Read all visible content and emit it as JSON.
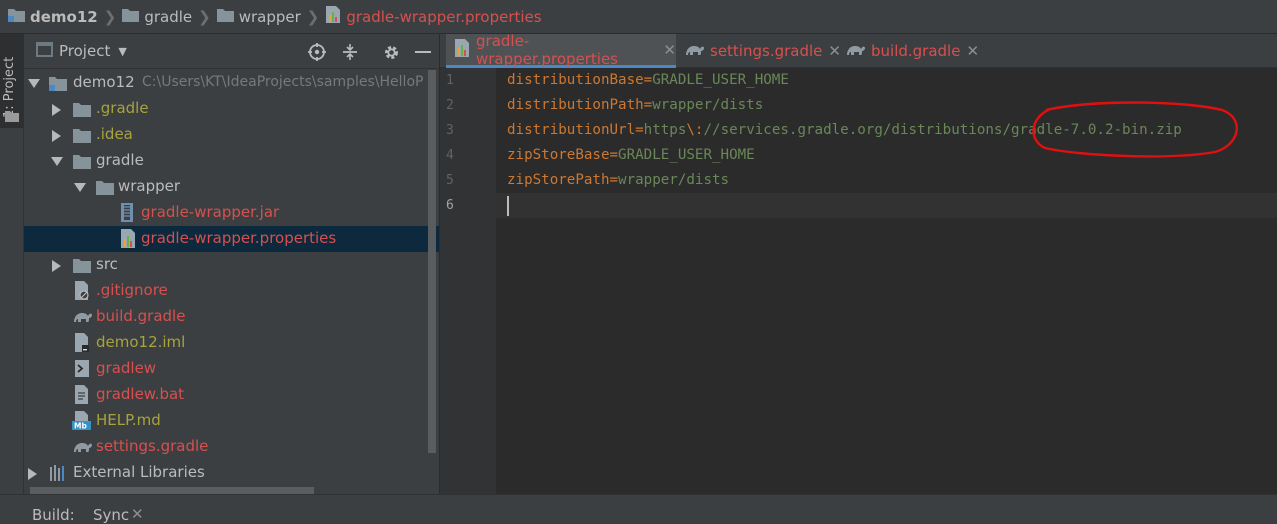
{
  "navbar": {
    "breadcrumbs": [
      {
        "label": "demo12",
        "icon": "project-folder-icon"
      },
      {
        "label": "gradle",
        "icon": "folder-icon"
      },
      {
        "label": "wrapper",
        "icon": "folder-icon"
      },
      {
        "label": "gradle-wrapper.properties",
        "icon": "properties-file-icon"
      }
    ]
  },
  "left_strip": {
    "project_tab": "1: Project"
  },
  "project_panel": {
    "title": "Project",
    "tools": [
      "locate-icon",
      "collapse-all-icon",
      "gear-icon",
      "hide-icon"
    ],
    "tree": [
      {
        "label": "demo12",
        "path": "C:\\Users\\KT\\IdeaProjects\\samples\\HelloP",
        "icon": "module-folder-icon",
        "expanded": true,
        "color": "default"
      },
      {
        "label": ".gradle",
        "icon": "folder-icon",
        "expanded": false,
        "color": "yellow"
      },
      {
        "label": ".idea",
        "icon": "folder-icon",
        "expanded": false,
        "color": "yellow"
      },
      {
        "label": "gradle",
        "icon": "folder-icon",
        "expanded": true,
        "color": "default"
      },
      {
        "label": "wrapper",
        "icon": "folder-icon",
        "expanded": true,
        "color": "default"
      },
      {
        "label": "gradle-wrapper.jar",
        "icon": "jar-file-icon",
        "color": "red"
      },
      {
        "label": "gradle-wrapper.properties",
        "icon": "properties-file-icon",
        "color": "red",
        "selected": true
      },
      {
        "label": "src",
        "icon": "folder-icon",
        "expanded": false,
        "color": "default"
      },
      {
        "label": ".gitignore",
        "icon": "gitignore-file-icon",
        "color": "red"
      },
      {
        "label": "build.gradle",
        "icon": "gradle-file-icon",
        "color": "red"
      },
      {
        "label": "demo12.iml",
        "icon": "iml-file-icon",
        "color": "yellow"
      },
      {
        "label": "gradlew",
        "icon": "shell-script-icon",
        "color": "red"
      },
      {
        "label": "gradlew.bat",
        "icon": "bat-file-icon",
        "color": "red"
      },
      {
        "label": "HELP.md",
        "icon": "markdown-file-icon",
        "color": "yellow"
      },
      {
        "label": "settings.gradle",
        "icon": "gradle-file-icon",
        "color": "red"
      },
      {
        "label": "External Libraries",
        "icon": "libraries-icon",
        "expanded": false,
        "color": "default"
      }
    ]
  },
  "editor": {
    "tabs": [
      {
        "label": "gradle-wrapper.properties",
        "icon": "properties-file-icon",
        "active": true,
        "color": "red"
      },
      {
        "label": "settings.gradle",
        "icon": "gradle-file-icon",
        "active": false,
        "color": "red"
      },
      {
        "label": "build.gradle",
        "icon": "gradle-file-icon",
        "active": false,
        "color": "red"
      }
    ],
    "lines": [
      {
        "num": "1",
        "key": "distributionBase",
        "value": "GRADLE_USER_HOME"
      },
      {
        "num": "2",
        "key": "distributionPath",
        "value": "wrapper/dists"
      },
      {
        "num": "3",
        "key": "distributionUrl",
        "value_a": "https",
        "value_esc": "\\:",
        "value_b": "//services.gradle.org/distributions/gradle-7.0.2-bin.zip"
      },
      {
        "num": "4",
        "key": "zipStoreBase",
        "value": "GRADLE_USER_HOME"
      },
      {
        "num": "5",
        "key": "zipStorePath",
        "value": "wrapper/dists"
      },
      {
        "num": "6",
        "key": "",
        "value": ""
      }
    ],
    "current_line": "6"
  },
  "bottom": {
    "build_label": "Build:",
    "sync_tab": "Sync"
  },
  "colors": {
    "bg": "#2b2b2b",
    "panel": "#3c3f41",
    "selection": "#0d293e",
    "accent": "#4a88c7",
    "key": "#cc7832",
    "value": "#6a8759",
    "vcs_red": "#d7504f",
    "vcs_yellow": "#a8a33c",
    "annotation": "#e01010"
  }
}
